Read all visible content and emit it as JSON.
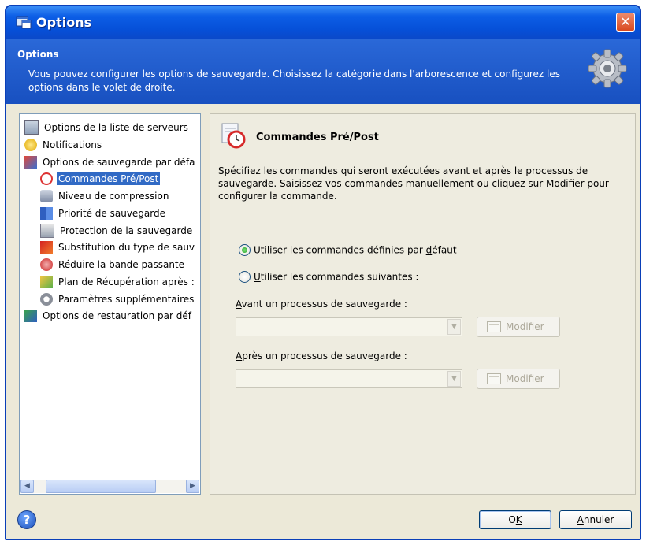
{
  "window": {
    "title": "Options",
    "close_glyph": "✕"
  },
  "header": {
    "title": "Options",
    "description": "Vous pouvez configurer les options de sauvegarde. Choisissez la catégorie dans l'arborescence et configurez les options dans le volet de droite."
  },
  "tree": {
    "items": [
      {
        "label": "Options de la liste de serveurs",
        "icon": "server-list-icon",
        "level": 0
      },
      {
        "label": "Notifications",
        "icon": "notification-icon",
        "level": 0
      },
      {
        "label": "Options de sauvegarde par défa",
        "icon": "backup-options-icon",
        "level": 0
      },
      {
        "label": "Commandes Pré/Post",
        "icon": "pre-post-commands-icon",
        "level": 1,
        "selected": true
      },
      {
        "label": "Niveau de compression",
        "icon": "compression-icon",
        "level": 1
      },
      {
        "label": "Priorité de sauvegarde",
        "icon": "priority-icon",
        "level": 1
      },
      {
        "label": "Protection de la sauvegarde",
        "icon": "protection-icon",
        "level": 1
      },
      {
        "label": "Substitution du type de sauv",
        "icon": "substitution-icon",
        "level": 1
      },
      {
        "label": "Réduire la bande passante",
        "icon": "bandwidth-icon",
        "level": 1
      },
      {
        "label": "Plan de Récupération après :",
        "icon": "recovery-plan-icon",
        "level": 1
      },
      {
        "label": "Paramètres supplémentaires",
        "icon": "additional-settings-icon",
        "level": 1
      },
      {
        "label": "Options de restauration par déf",
        "icon": "restore-options-icon",
        "level": 0
      }
    ]
  },
  "panel": {
    "title": "Commandes Pré/Post",
    "description": "Spécifiez les commandes qui seront exécutées avant et après le processus de sauvegarde. Saisissez vos commandes manuellement ou cliquez sur Modifier pour configurer la commande.",
    "radio_default": {
      "pre": "Utiliser les commandes définies par ",
      "key": "d",
      "post": "éfaut",
      "checked": true
    },
    "radio_custom": {
      "pre": "",
      "key": "U",
      "post": "tiliser les commandes suivantes :",
      "checked": false
    },
    "before_label": {
      "key": "A",
      "post": "vant un processus de sauvegarde :"
    },
    "after_label": {
      "key": "A",
      "post": "près un processus de sauvegarde :"
    },
    "before_value": "",
    "after_value": "",
    "modify_label": "Modifier"
  },
  "footer": {
    "help_glyph": "?",
    "ok": {
      "key": "K",
      "pre": "O"
    },
    "cancel": {
      "key": "A",
      "post": "nnuler"
    }
  }
}
